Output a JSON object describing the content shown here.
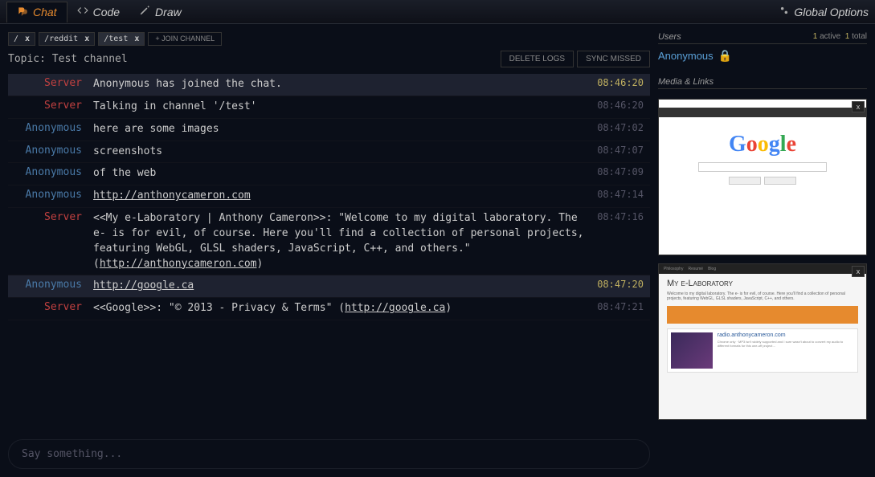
{
  "nav": {
    "chat": "Chat",
    "code": "Code",
    "draw": "Draw",
    "global": "Global Options"
  },
  "channels": [
    {
      "name": "/",
      "active": false
    },
    {
      "name": "/reddit",
      "active": false
    },
    {
      "name": "/test",
      "active": true
    }
  ],
  "join_label": "+ JOIN CHANNEL",
  "topic": "Topic: Test channel",
  "buttons": {
    "delete": "DELETE LOGS",
    "sync": "SYNC MISSED"
  },
  "messages": [
    {
      "nick": "Server",
      "kind": "server",
      "hl": true,
      "body": "Anonymous has joined the chat.",
      "time": "08:46:20"
    },
    {
      "nick": "Server",
      "kind": "server",
      "body": "Talking in channel '/test'",
      "time": "08:46:20"
    },
    {
      "nick": "Anonymous",
      "kind": "user",
      "body": "here are some images",
      "time": "08:47:02"
    },
    {
      "nick": "Anonymous",
      "kind": "user",
      "body": "screenshots",
      "time": "08:47:07"
    },
    {
      "nick": "Anonymous",
      "kind": "user",
      "body": "of the web",
      "time": "08:47:09"
    },
    {
      "nick": "Anonymous",
      "kind": "user",
      "link": "http://anthonycameron.com",
      "time": "08:47:14"
    },
    {
      "nick": "Server",
      "kind": "server",
      "body": "<<My e-Laboratory | Anthony Cameron>>: \"Welcome to my digital laboratory. The e- is for evil, of course. Here you'll find a collection of personal projects, featuring WebGL, GLSL shaders, JavaScript, C++, and others.\" (",
      "trail_link": "http://anthonycameron.com",
      "trail": ")",
      "time": "08:47:16"
    },
    {
      "nick": "Anonymous",
      "kind": "user",
      "hl": true,
      "link": "http://google.ca",
      "time": "08:47:20"
    },
    {
      "nick": "Server",
      "kind": "server",
      "body": "<<Google>>: \"© 2013 - Privacy & Terms\" (",
      "trail_link": "http://google.ca",
      "trail": ")",
      "time": "08:47:21"
    }
  ],
  "input_placeholder": "Say something...",
  "users": {
    "header": "Users",
    "active_n": "1",
    "active_l": "active",
    "total_n": "1",
    "total_l": "total",
    "list": [
      {
        "name": "Anonymous"
      }
    ]
  },
  "media": {
    "header": "Media & Links"
  },
  "thumbs": [
    {
      "kind": "google"
    },
    {
      "kind": "ac",
      "nav": [
        "Philosophy",
        "Resumé",
        "Blog"
      ],
      "title": "My e-Laboratory",
      "card_title": "radio.anthonycameron.com"
    }
  ]
}
